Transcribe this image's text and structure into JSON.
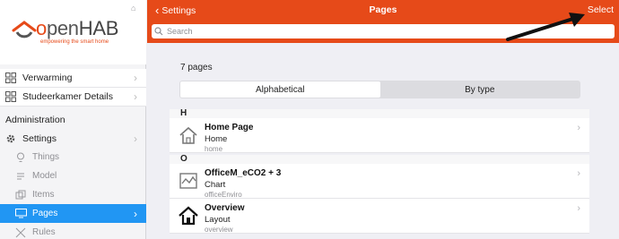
{
  "brand": {
    "name_o": "o",
    "name_pen": "pen",
    "name_hab": "HAB",
    "tagline": "empowering the smart home"
  },
  "sidebar": {
    "top_items": [
      {
        "label": "Verwarming",
        "icon": "grid-icon"
      },
      {
        "label": "Studeerkamer Details",
        "icon": "grid-icon"
      }
    ],
    "section_title": "Administration",
    "settings": {
      "label": "Settings",
      "icon": "gear-icon"
    },
    "sub_items": [
      {
        "label": "Things",
        "icon": "lightbulb-icon"
      },
      {
        "label": "Model",
        "icon": "model-icon"
      },
      {
        "label": "Items",
        "icon": "items-icon"
      },
      {
        "label": "Pages",
        "icon": "monitor-icon",
        "active": true
      },
      {
        "label": "Rules",
        "icon": "rules-icon"
      }
    ]
  },
  "navbar": {
    "back_label": "Settings",
    "title": "Pages",
    "select_label": "Select",
    "search_placeholder": "Search",
    "color": "#e64a19"
  },
  "main": {
    "count_text": "7 pages",
    "tabs": [
      {
        "label": "Alphabetical",
        "selected": true
      },
      {
        "label": "By type",
        "selected": false
      }
    ],
    "groups": [
      {
        "letter": "H",
        "rows": [
          {
            "title": "Home Page",
            "type": "Home",
            "uid": "home",
            "icon": "house-outline-icon"
          }
        ]
      },
      {
        "letter": "O",
        "rows": [
          {
            "title": "OfficeM_eCO2 + 3",
            "type": "Chart",
            "uid": "officeEnviro",
            "icon": "chart-icon"
          },
          {
            "title": "Overview",
            "type": "Layout",
            "uid": "overview",
            "icon": "house-solid-icon"
          }
        ]
      }
    ]
  },
  "colors": {
    "accent": "#e64a19",
    "active": "#2196f3"
  }
}
